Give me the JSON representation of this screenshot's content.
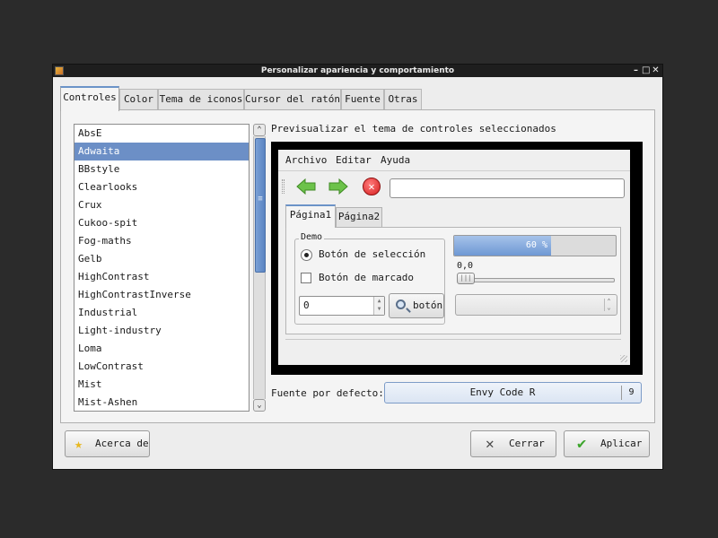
{
  "window": {
    "title": "Personalizar apariencia y comportamiento",
    "controls": {
      "minimize": "–",
      "maximize": "□",
      "close": "✕"
    }
  },
  "tabs": [
    {
      "label": "Controles",
      "active": true
    },
    {
      "label": "Color"
    },
    {
      "label": "Tema de iconos"
    },
    {
      "label": "Cursor del ratón"
    },
    {
      "label": "Fuente"
    },
    {
      "label": "Otras"
    }
  ],
  "theme_list": {
    "items": [
      "AbsE",
      "Adwaita",
      "BBstyle",
      "Clearlooks",
      "Crux",
      "Cukoo-spit",
      "Fog-maths",
      "Gelb",
      "HighContrast",
      "HighContrastInverse",
      "Industrial",
      "Light-industry",
      "Loma",
      "LowContrast",
      "Mist",
      "Mist-Ashen"
    ],
    "selected": "Adwaita"
  },
  "preview": {
    "label": "Previsualizar el tema de controles seleccionados",
    "menus": [
      "Archivo",
      "Editar",
      "Ayuda"
    ],
    "entry_value": "",
    "tabs": [
      "Página1",
      "Página2"
    ],
    "demo": {
      "legend": "Demo",
      "radio_label": "Botón de selección",
      "check_label": "Botón de marcado",
      "spin_value": "0",
      "button_label": "botón",
      "progress_text": "60 %",
      "progress_value": 0.6,
      "scale_value": "0,0"
    }
  },
  "font": {
    "label": "Fuente por defecto:",
    "name": "Envy Code R",
    "size": "9"
  },
  "buttons": {
    "about": "Acerca de",
    "close": "Cerrar",
    "apply": "Aplicar"
  },
  "colors": {
    "selection": "#6c8fc6",
    "titlebar": "#1e1e1e",
    "background": "#ededed",
    "accent": "#6b93c8"
  }
}
